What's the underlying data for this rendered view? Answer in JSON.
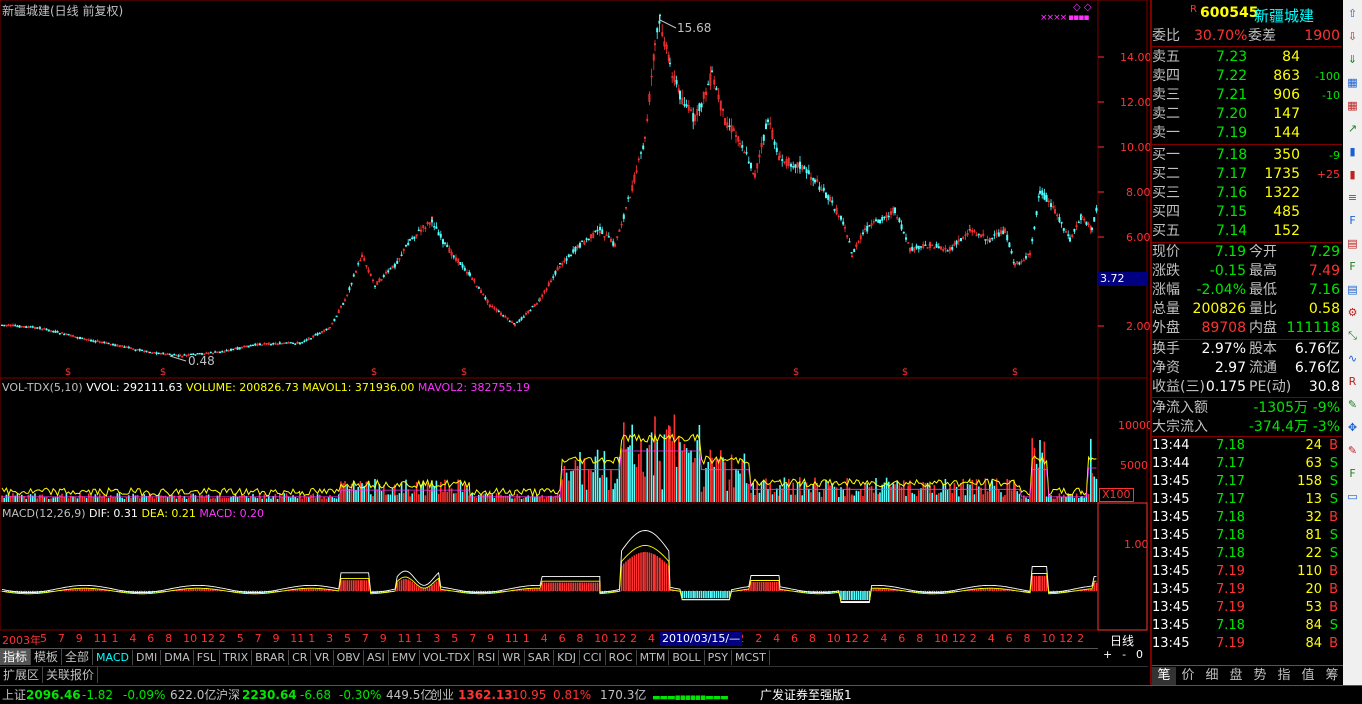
{
  "chart_title": "新疆城建(日线 前复权)",
  "price_axis": [
    "14.00",
    "12.00",
    "10.00",
    "8.00",
    "6.00",
    "2.00"
  ],
  "price_marker": "3.72",
  "high_label": "15.68",
  "low_label": "0.48",
  "vol_title": {
    "name": "VOL-TDX(5,10)",
    "vvol": "VVOL: 292111.63",
    "volume": "VOLUME: 200826.73",
    "mavol1": "MAVOL1: 371936.00",
    "mavol2": "MAVOL2: 382755.19"
  },
  "vol_axis": [
    "10000",
    "5000"
  ],
  "vol_unit": "X100",
  "macd_title": {
    "name": "MACD(12,26,9)",
    "dif": "DIF: 0.31",
    "dea": "DEA: 0.21",
    "macd": "MACD: 0.20"
  },
  "macd_axis": [
    "1.00"
  ],
  "date_axis": [
    "2003年",
    "5",
    "7",
    "9",
    "11",
    "1",
    "4",
    "6",
    "8",
    "10",
    "12",
    "2",
    "5",
    "7",
    "9",
    "11",
    "1",
    "3",
    "5",
    "7",
    "9",
    "11",
    "1",
    "3",
    "5",
    "7",
    "9",
    "11",
    "1",
    "4",
    "6",
    "8",
    "10",
    "12",
    "2",
    "4",
    "6",
    "8",
    "10",
    "12",
    "2",
    "2",
    "4",
    "6",
    "8",
    "10",
    "12",
    "2",
    "4",
    "6",
    "8",
    "10",
    "12",
    "2",
    "4",
    "6",
    "8",
    "10",
    "12",
    "2"
  ],
  "cursor_date": "2010/03/15/—",
  "period_label": "日线",
  "indicator_tabs": [
    "指标",
    "模板",
    "全部",
    "MACD",
    "DMI",
    "DMA",
    "FSL",
    "TRIX",
    "BRAR",
    "CR",
    "VR",
    "OBV",
    "ASI",
    "EMV",
    "VOL-TDX",
    "RSI",
    "WR",
    "SAR",
    "KDJ",
    "CCI",
    "ROC",
    "MTM",
    "BOLL",
    "PSY",
    "MCST"
  ],
  "ext_tabs": [
    "扩展区",
    "关联报价"
  ],
  "zoom_buttons": [
    "+",
    "-",
    "0"
  ],
  "stock": {
    "r_badge": "R",
    "code": "600545",
    "name": "新疆城建"
  },
  "weibi": {
    "label1": "委比",
    "val1": "30.70%",
    "label2": "委差",
    "val2": "1900"
  },
  "asks": [
    {
      "label": "卖五",
      "price": "7.23",
      "vol": "84",
      "chg": ""
    },
    {
      "label": "卖四",
      "price": "7.22",
      "vol": "863",
      "chg": "-100"
    },
    {
      "label": "卖三",
      "price": "7.21",
      "vol": "906",
      "chg": "-10"
    },
    {
      "label": "卖二",
      "price": "7.20",
      "vol": "147",
      "chg": ""
    },
    {
      "label": "卖一",
      "price": "7.19",
      "vol": "144",
      "chg": ""
    }
  ],
  "bids": [
    {
      "label": "买一",
      "price": "7.18",
      "vol": "350",
      "chg": "-9"
    },
    {
      "label": "买二",
      "price": "7.17",
      "vol": "1735",
      "chg": "+25"
    },
    {
      "label": "买三",
      "price": "7.16",
      "vol": "1322",
      "chg": ""
    },
    {
      "label": "买四",
      "price": "7.15",
      "vol": "485",
      "chg": ""
    },
    {
      "label": "买五",
      "price": "7.14",
      "vol": "152",
      "chg": ""
    }
  ],
  "quote": [
    {
      "l1": "现价",
      "v1": "7.19",
      "l2": "今开",
      "v2": "7.29"
    },
    {
      "l1": "涨跌",
      "v1": "-0.15",
      "l2": "最高",
      "v2": "7.49"
    },
    {
      "l1": "涨幅",
      "v1": "-2.04%",
      "l2": "最低",
      "v2": "7.16"
    },
    {
      "l1": "总量",
      "v1": "200826",
      "l2": "量比",
      "v2": "0.58"
    },
    {
      "l1": "外盘",
      "v1": "89708",
      "l2": "内盘",
      "v2": "111118"
    }
  ],
  "fund": [
    {
      "l1": "换手",
      "v1": "2.97%",
      "l2": "股本",
      "v2": "6.76亿"
    },
    {
      "l1": "净资",
      "v1": "2.97",
      "l2": "流通",
      "v2": "6.76亿"
    },
    {
      "l1": "收益(三)",
      "v1": "0.175",
      "l2": "PE(动)",
      "v2": "30.8"
    }
  ],
  "flow": [
    {
      "label": "净流入额",
      "val": "-1305万",
      "pct": "-9%"
    },
    {
      "label": "大宗流入",
      "val": "-374.4万",
      "pct": "-3%"
    }
  ],
  "ticks": [
    {
      "time": "13:44",
      "price": "7.18",
      "vol": "24",
      "bs": "B"
    },
    {
      "time": "13:44",
      "price": "7.17",
      "vol": "63",
      "bs": "S"
    },
    {
      "time": "13:45",
      "price": "7.17",
      "vol": "158",
      "bs": "S"
    },
    {
      "time": "13:45",
      "price": "7.17",
      "vol": "13",
      "bs": "S"
    },
    {
      "time": "13:45",
      "price": "7.18",
      "vol": "32",
      "bs": "B"
    },
    {
      "time": "13:45",
      "price": "7.18",
      "vol": "81",
      "bs": "S"
    },
    {
      "time": "13:45",
      "price": "7.18",
      "vol": "22",
      "bs": "S"
    },
    {
      "time": "13:45",
      "price": "7.19",
      "vol": "110",
      "bs": "B"
    },
    {
      "time": "13:45",
      "price": "7.19",
      "vol": "20",
      "bs": "B"
    },
    {
      "time": "13:45",
      "price": "7.19",
      "vol": "53",
      "bs": "B"
    },
    {
      "time": "13:45",
      "price": "7.18",
      "vol": "84",
      "bs": "S"
    },
    {
      "time": "13:45",
      "price": "7.19",
      "vol": "84",
      "bs": "B"
    }
  ],
  "bottom_tabs": [
    "笔",
    "价",
    "细",
    "盘",
    "势",
    "指",
    "值",
    "筹"
  ],
  "status": {
    "sh_label": "上证",
    "sh_val": "2096.46",
    "sh_chg": "-1.82",
    "sh_pct": "-0.09%",
    "sh_amt": "622.0亿",
    "sz_label": "沪深",
    "sz_val": "2230.64",
    "sz_chg": "-6.68",
    "sz_pct": "-0.30%",
    "sz_amt": "449.5亿",
    "cy_label": "创业",
    "cy_val": "1362.13",
    "cy_chg": "10.95",
    "cy_pct": "0.81%",
    "cy_amt": "170.3亿",
    "broker": "广发证券至强版1"
  },
  "toolbar_icons": [
    "arrow-up-icon",
    "arrow-down-icon",
    "arrow-down-outline-icon",
    "bar-chart-icon",
    "grid-icon",
    "line-chart-icon",
    "candle-icon",
    "candle-red-icon",
    "list-icon",
    "f10-icon",
    "doc-icon",
    "f-icon",
    "table-icon",
    "gear-icon",
    "zoom-icon",
    "wave-icon",
    "rsi-icon",
    "pencil-icon",
    "move-icon",
    "draw-icon",
    "f5-icon",
    "window-icon"
  ],
  "colors": {
    "up": "#ff3232",
    "down": "#54ffff",
    "dif": "#ffffff",
    "dea": "#ffff00",
    "macd_label": "#ff33ff",
    "accent_blue": "#000080"
  }
}
